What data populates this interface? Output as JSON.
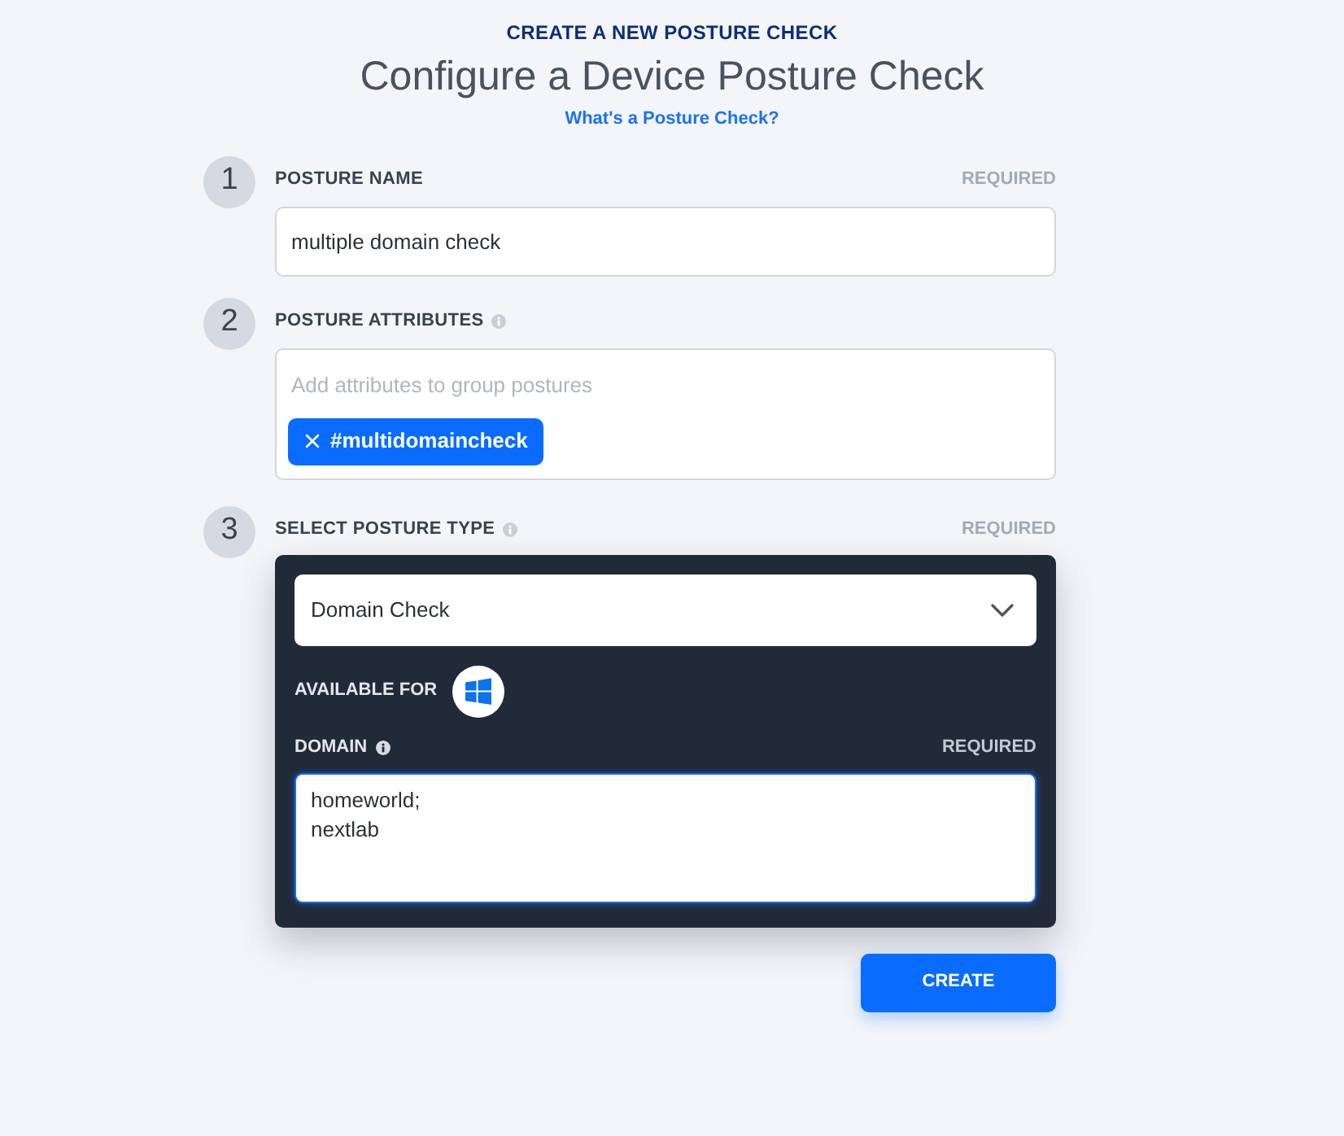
{
  "header": {
    "eyebrow": "CREATE A NEW POSTURE CHECK",
    "title": "Configure a Device Posture Check",
    "help_link": "What's a Posture Check?"
  },
  "steps": [
    {
      "number": "1",
      "label": "POSTURE NAME",
      "info": false,
      "required": "REQUIRED",
      "kind": "text",
      "value": "multiple domain check"
    },
    {
      "number": "2",
      "label": "POSTURE ATTRIBUTES",
      "info": true,
      "kind": "tags",
      "placeholder": "Add attributes to group postures",
      "tags": [
        "#multidomaincheck"
      ]
    },
    {
      "number": "3",
      "label": "SELECT POSTURE TYPE",
      "info": true,
      "required": "REQUIRED",
      "kind": "posture_type",
      "select": {
        "value": "Domain Check"
      },
      "available_for": "AVAILABLE FOR",
      "domain": {
        "label": "DOMAIN",
        "info": true,
        "required": "REQUIRED",
        "value": "homeworld;\nnextlab",
        "focused": true
      }
    }
  ],
  "create_button": "CREATE"
}
